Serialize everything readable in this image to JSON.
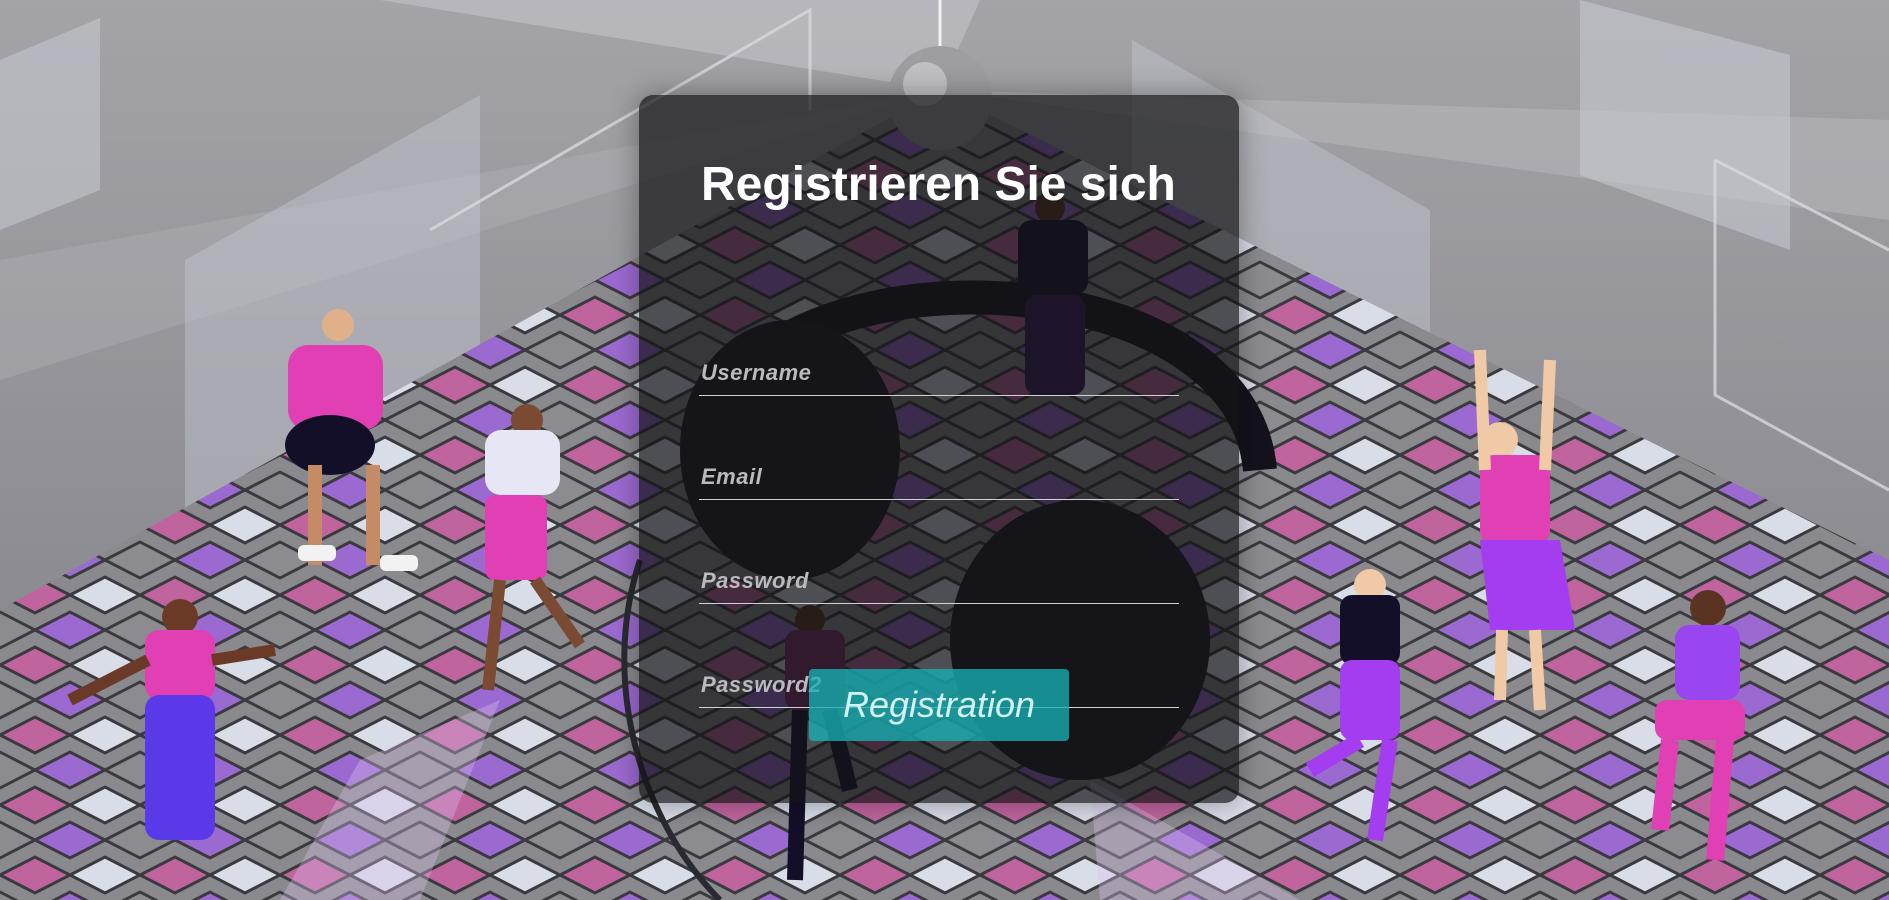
{
  "form": {
    "title": "Registrieren Sie sich",
    "fields": [
      {
        "name": "username",
        "placeholder": "Username",
        "value": ""
      },
      {
        "name": "email",
        "placeholder": "Email",
        "value": ""
      },
      {
        "name": "password",
        "placeholder": "Password",
        "value": ""
      },
      {
        "name": "password2",
        "placeholder": "Password2",
        "value": ""
      }
    ],
    "submit_label": "Registration"
  },
  "background": {
    "scene": "disco-dance-floor",
    "colors": {
      "sky": "#8e8e94",
      "tile_pink": "#c0649e",
      "tile_purple": "#9b6ad0",
      "tile_light": "#d9dde8",
      "tile_gray": "#8c8c90",
      "accent_button": "#16b0b4"
    }
  }
}
